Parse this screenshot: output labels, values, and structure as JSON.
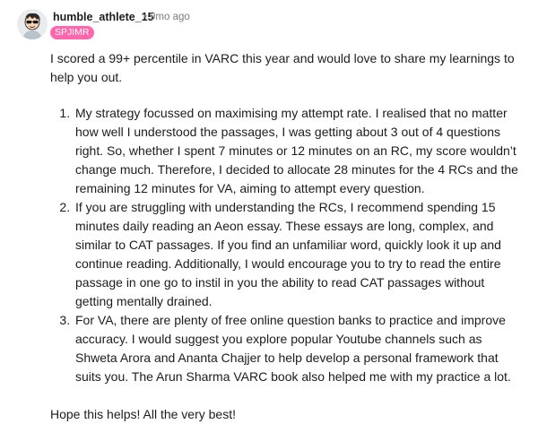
{
  "post": {
    "author": "humble_athlete_15",
    "separator": "•",
    "time_ago": "9mo ago",
    "flair": "SPJIMR",
    "avatar_icon": "cartoon-avatar-icon",
    "colors": {
      "flair_bg": "#ff66ac",
      "muted_text": "#7c7c7c"
    },
    "intro": "I scored a 99+ percentile in VARC this year and would love to share my learnings to help you out.",
    "points": [
      "My strategy focussed on maximising my attempt rate. I realised that no matter how well I understood the passages, I was getting about 3 out of 4 questions right. So, whether I spent 7 minutes or 12 minutes on an RC, my score wouldn’t change much. Therefore, I decided to allocate 28 minutes for the 4 RCs and the remaining 12 minutes for VA, aiming to attempt every question.",
      "If you are struggling with understanding the RCs, I recommend spending 15 minutes daily reading an Aeon essay. These essays are long, complex, and similar to CAT passages. If you find an unfamiliar word, quickly look it up and continue reading. Additionally, I would encourage you to try to read the entire passage in one go to instil in you the ability to read CAT passages without getting mentally drained.",
      "For VA, there are plenty of free online question banks to practice and improve accuracy. I would suggest you explore popular Youtube channels such as Shweta Arora and Ananta Chajjer to help develop a personal framework that suits you. The Arun Sharma VARC book also helped me with my practice a lot."
    ],
    "closing": "Hope this helps! All the very best!"
  }
}
